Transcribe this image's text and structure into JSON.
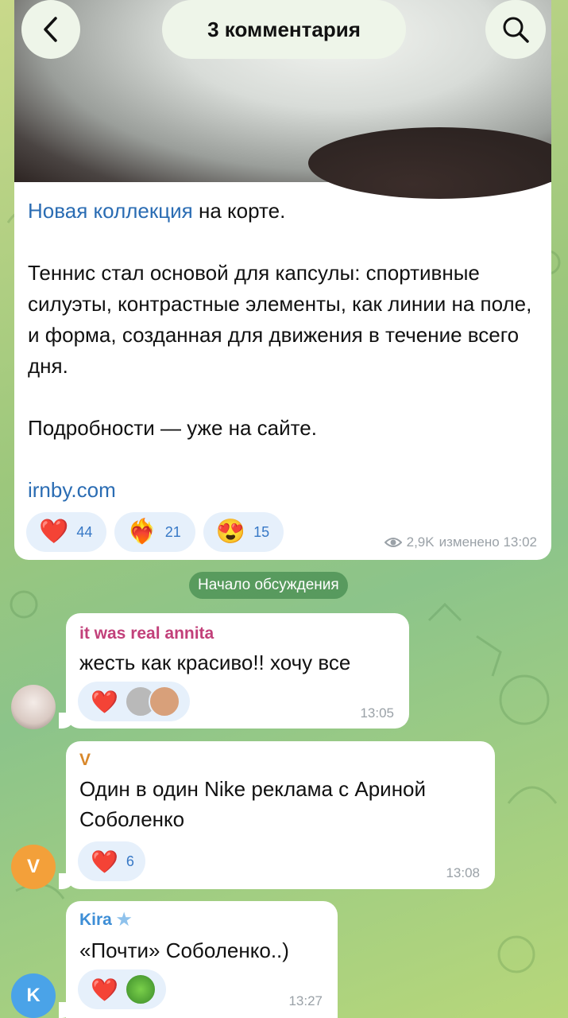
{
  "header": {
    "title": "3 комментария",
    "back_icon": "chevron-left-icon",
    "search_icon": "search-icon"
  },
  "post": {
    "link_text": "Новая коллекция",
    "line1_rest": " на корте.",
    "paragraph2": "Теннис стал основой для капсулы: спортивные силуэты, контрастные элементы, как линии на поле, и форма, созданная для движения в течение всего дня.",
    "paragraph3": "Подробности — уже на сайте.",
    "site_link": "irnby.com",
    "reactions": [
      {
        "emoji": "❤️",
        "count": "44"
      },
      {
        "emoji": "❤️‍🔥",
        "count": "21"
      },
      {
        "emoji": "😍",
        "count": "15"
      }
    ],
    "views": "2,9K",
    "edited": "изменено 13:02"
  },
  "service_label": "Начало обсуждения",
  "comments": [
    {
      "author": "it was real annita",
      "author_color": "#c2407a",
      "text": "жесть как красиво!! хочу все",
      "reaction": "❤️",
      "count": "",
      "time": "13:05"
    },
    {
      "author": "V",
      "author_color": "#d8872a",
      "text": "Один в один Nike реклама с Ариной Соболенко",
      "reaction": "❤️",
      "count": "6",
      "time": "13:08",
      "avatar_letter": "V",
      "avatar_color": "#f3a03a"
    },
    {
      "author": "Kira",
      "author_color": "#3d8ed6",
      "text": "«Почти» Соболенко..)",
      "reaction": "❤️",
      "count": "",
      "time": "13:27",
      "avatar_letter": "K",
      "avatar_color": "#4aa3e8",
      "badge_icon": "star-badge-icon"
    }
  ]
}
